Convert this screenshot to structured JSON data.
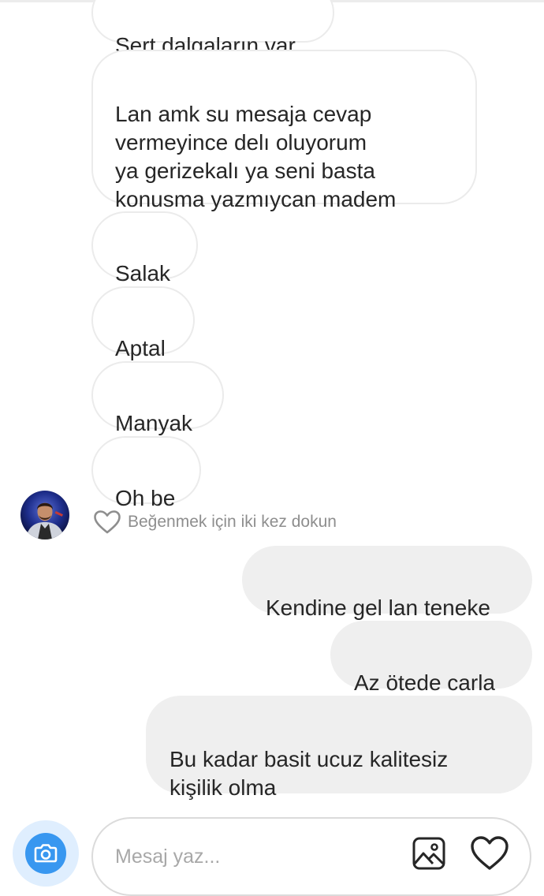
{
  "thread": {
    "incoming": [
      {
        "text": "Sert dalgaların var"
      },
      {
        "text": "Lan amk su mesaja cevap\nvermeyince delı oluyorum\nya gerizekalı ya seni basta\nkonusma yazmıycan madem"
      },
      {
        "text": "Salak"
      },
      {
        "text": "Aptal"
      },
      {
        "text": "Manyak"
      },
      {
        "text": "Oh be"
      }
    ],
    "like_hint": "Beğenmek için iki kez dokun",
    "outgoing": [
      {
        "text": "Kendine gel lan teneke"
      },
      {
        "text": "Az ötede carla"
      },
      {
        "text": "Bu kadar basit ucuz kalitesiz\nkişilik olma"
      }
    ]
  },
  "composer": {
    "placeholder": "Mesaj yaz...",
    "value": ""
  },
  "icons": {
    "camera": "camera-icon",
    "gallery": "gallery-icon",
    "heart": "heart-icon",
    "like_hint": "heart-outline-icon"
  },
  "colors": {
    "accent": "#3897f0",
    "outgoing_bubble": "#efefef",
    "incoming_border": "#ebebeb",
    "muted_text": "#8e8e8e"
  }
}
